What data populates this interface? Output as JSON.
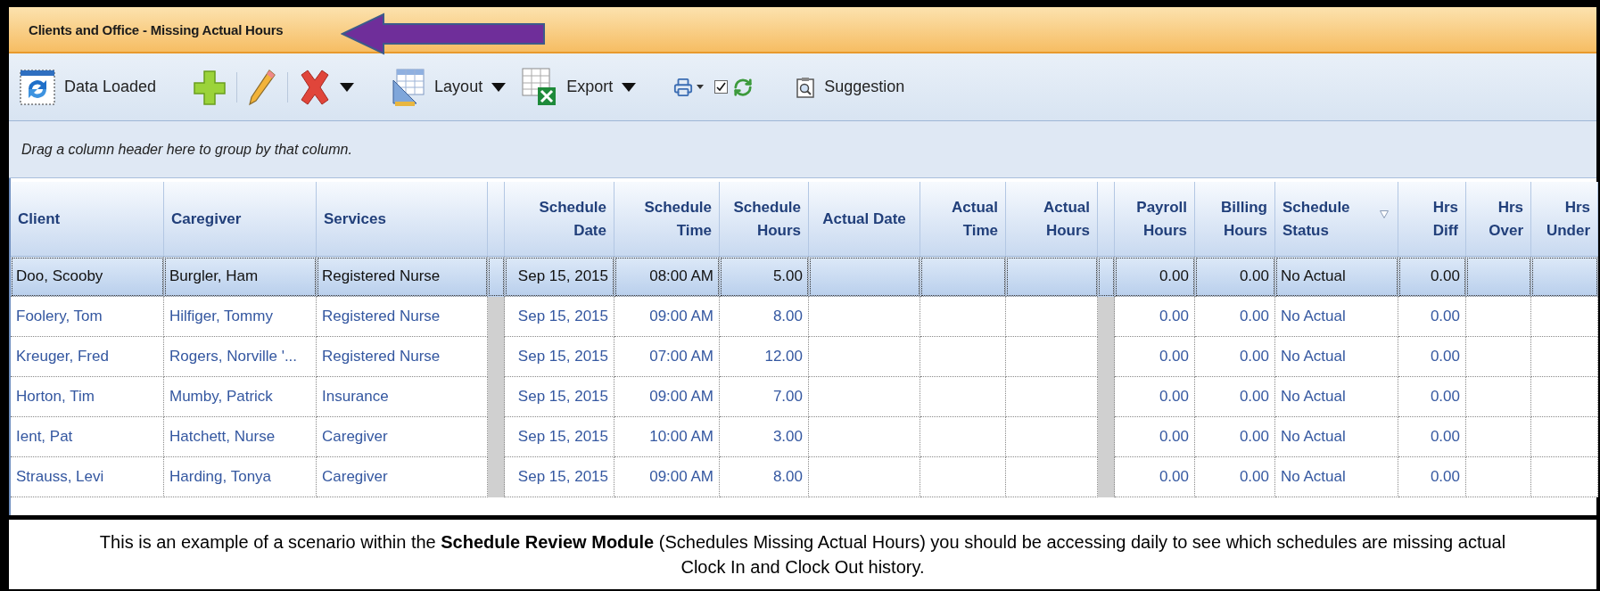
{
  "window": {
    "title": "Clients and Office - Missing Actual Hours"
  },
  "toolbar": {
    "status_label": "Data Loaded",
    "layout_label": "Layout",
    "export_label": "Export",
    "auto_refresh": {
      "checked": true
    },
    "suggestion_label": "Suggestion"
  },
  "group_panel": {
    "hint": "Drag a column header here to group by that column."
  },
  "table": {
    "column_groups": [
      [
        {
          "lines": [
            "Client"
          ]
        },
        {
          "lines": [
            "Caregiver"
          ]
        },
        {
          "lines": [
            "Services"
          ]
        }
      ],
      [
        {
          "lines": [
            "Schedule",
            "Date"
          ]
        },
        {
          "lines": [
            "Schedule",
            "Time"
          ]
        },
        {
          "lines": [
            "Schedule",
            "Hours"
          ]
        },
        {
          "lines": [
            "Actual Date"
          ]
        },
        {
          "lines": [
            "Actual",
            "Time"
          ]
        },
        {
          "lines": [
            "Actual",
            "Hours"
          ]
        }
      ],
      [
        {
          "lines": [
            "Payroll",
            "Hours"
          ]
        },
        {
          "lines": [
            "Billing",
            "Hours"
          ]
        },
        {
          "lines": [
            "Schedule",
            "Status"
          ]
        },
        {
          "lines": [
            "Hrs",
            "Diff"
          ]
        },
        {
          "lines": [
            "Hrs",
            "Over"
          ]
        },
        {
          "lines": [
            "Hrs",
            "Under"
          ]
        }
      ]
    ],
    "rows": [
      {
        "selected": true,
        "cells": [
          "Doo, Scooby",
          "Burgler, Ham",
          "Registered Nurse",
          "Sep 15, 2015",
          "08:00 AM",
          "5.00",
          null,
          null,
          null,
          "0.00",
          "0.00",
          "No Actual",
          "0.00",
          null,
          null
        ]
      },
      {
        "selected": false,
        "cells": [
          "Foolery, Tom",
          "Hilfiger, Tommy",
          "Registered Nurse",
          "Sep 15, 2015",
          "09:00 AM",
          "8.00",
          null,
          null,
          null,
          "0.00",
          "0.00",
          "No Actual",
          "0.00",
          null,
          null
        ]
      },
      {
        "selected": false,
        "cells": [
          "Kreuger, Fred",
          "Rogers, Norville '...",
          "Registered Nurse",
          "Sep 15, 2015",
          "07:00 AM",
          "12.00",
          null,
          null,
          null,
          "0.00",
          "0.00",
          "No Actual",
          "0.00",
          null,
          null
        ]
      },
      {
        "selected": false,
        "cells": [
          "Horton, Tim",
          "Mumby, Patrick",
          "Insurance",
          "Sep 15, 2015",
          "09:00 AM",
          "7.00",
          null,
          null,
          null,
          "0.00",
          "0.00",
          "No Actual",
          "0.00",
          null,
          null
        ]
      },
      {
        "selected": false,
        "cells": [
          "Ient, Pat",
          "Hatchett, Nurse",
          "Caregiver",
          "Sep 15, 2015",
          "10:00 AM",
          "3.00",
          null,
          null,
          null,
          "0.00",
          "0.00",
          "No Actual",
          "0.00",
          null,
          null
        ]
      },
      {
        "selected": false,
        "cells": [
          "Strauss, Levi",
          "Harding, Tonya",
          "Caregiver",
          "Sep 15, 2015",
          "09:00 AM",
          "8.00",
          null,
          null,
          null,
          "0.00",
          "0.00",
          "No Actual",
          "0.00",
          null,
          null
        ]
      }
    ]
  },
  "caption": "This is an example of a scenario within the **Schedule Review Module** (Schedules Missing Actual Hours) you should be accessing daily to see which schedules are missing actual Clock In and Clock Out history."
}
